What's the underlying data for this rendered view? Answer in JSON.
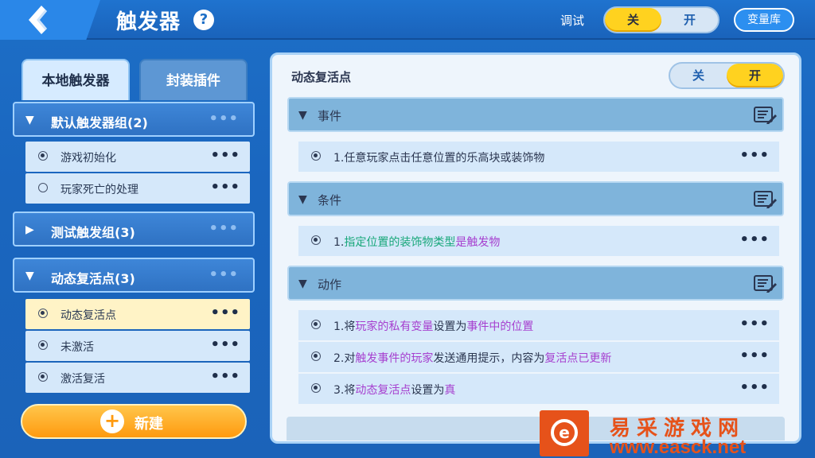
{
  "header": {
    "title": "触发器",
    "help_icon": "?",
    "debug_label": "调试",
    "debug_toggle": {
      "off_label": "关",
      "on_label": "开",
      "selected": "off"
    },
    "variable_library_label": "变量库"
  },
  "left_panel": {
    "tabs": [
      {
        "label": "本地触发器",
        "active": true
      },
      {
        "label": "封装插件",
        "active": false
      }
    ],
    "groups": [
      {
        "label": "默认触发器组(2)",
        "expanded": true,
        "more": "•••",
        "items": [
          {
            "label": "游戏初始化",
            "enabled": true,
            "more": "•••"
          },
          {
            "label": "玩家死亡的处理",
            "enabled": false,
            "more": "•••"
          }
        ]
      },
      {
        "label": "测试触发组(3)",
        "expanded": false,
        "more": "•••",
        "items": []
      },
      {
        "label": "动态复活点(3)",
        "expanded": true,
        "more": "•••",
        "items": [
          {
            "label": "动态复活点",
            "enabled": true,
            "selected": true,
            "more": "•••"
          },
          {
            "label": "未激活",
            "enabled": true,
            "more": "•••"
          },
          {
            "label": "激活复活",
            "enabled": true,
            "more": "•••"
          }
        ]
      }
    ],
    "new_button_label": "新建",
    "new_button_icon": "+"
  },
  "right_panel": {
    "title": "动态复活点",
    "toggle": {
      "off_label": "关",
      "on_label": "开",
      "selected": "on"
    },
    "sections": {
      "event": {
        "label": "事件",
        "icon": "edit-list-icon"
      },
      "condition": {
        "label": "条件",
        "icon": "edit-list-icon"
      },
      "action": {
        "label": "动作",
        "icon": "edit-list-icon"
      }
    },
    "event_rows": [
      {
        "parts": [
          "1.任意玩家点击任意位置的乐高块或装饰物"
        ]
      }
    ],
    "condition_rows": [
      {
        "parts": [
          "1.",
          "指定位置的装饰物类型",
          "是",
          "触发物"
        ]
      }
    ],
    "action_rows": [
      {
        "parts": [
          "1.将",
          "玩家的私有变量",
          "设置为",
          "事件中的位置"
        ]
      },
      {
        "parts": [
          "2.对",
          "触发事件的玩家",
          "发送通用提示，内容为",
          "复活点已更新"
        ]
      },
      {
        "parts": [
          "3.将",
          "动态复活点",
          "设置为",
          "真"
        ]
      }
    ],
    "more": "•••"
  },
  "watermark": {
    "logo_letter": "e",
    "name": "易采游戏网",
    "url": "www.easck.net"
  },
  "colors": {
    "accent_yellow": "#ffd21f",
    "button_orange": "#ff9a0f",
    "highlight_purple": "#a63fcf",
    "highlight_green": "#18a77a",
    "watermark_orange": "#e6521a"
  }
}
